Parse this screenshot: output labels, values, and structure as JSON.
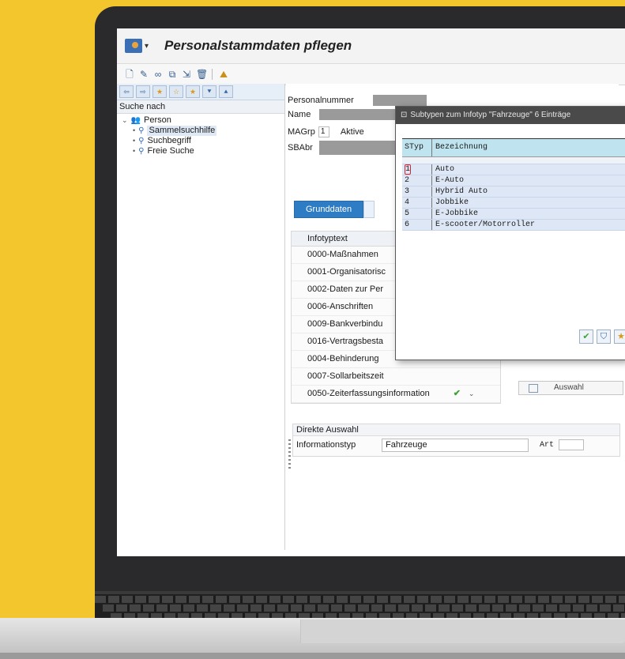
{
  "window": {
    "title": "Personalstammdaten pflegen"
  },
  "left_panel": {
    "header": "Suche nach",
    "tree": [
      {
        "label": "Person"
      },
      {
        "label": "Sammelsuchhilfe"
      },
      {
        "label": "Suchbegriff"
      },
      {
        "label": "Freie Suche"
      }
    ]
  },
  "header_fields": {
    "personalnummer_label": "Personalnummer",
    "name_label": "Name",
    "magrp_label": "MAGrp",
    "magrp_value": "1",
    "magrp_text": "Aktive",
    "sbabr_label": "SBAbr"
  },
  "tabs": [
    {
      "label": "Grunddaten"
    }
  ],
  "infotypes": {
    "header": "Infotyptext",
    "items": [
      "0000-Maßnahmen",
      "0001-Organisatorisc",
      "0002-Daten zur Per",
      "0006-Anschriften",
      "0009-Bankverbindu",
      "0016-Vertragsbesta",
      "0004-Behinderung",
      "0007-Sollarbeitszeit",
      "0050-Zeiterfassungsinformation"
    ]
  },
  "auswahl_label": "Auswahl",
  "direct": {
    "header": "Direkte Auswahl",
    "label": "Informationstyp",
    "value": "Fahrzeuge",
    "art_label": "Art"
  },
  "popup": {
    "title": "Subtypen zum Infotyp \"Fahrzeuge\" 6 Einträge",
    "col_styp": "STyp",
    "col_bez": "Bezeichnung",
    "rows": [
      {
        "styp": "1",
        "bez": "Auto"
      },
      {
        "styp": "2",
        "bez": "E-Auto"
      },
      {
        "styp": "3",
        "bez": "Hybrid Auto"
      },
      {
        "styp": "4",
        "bez": "Jobbike"
      },
      {
        "styp": "5",
        "bez": "E-Jobbike"
      },
      {
        "styp": "6",
        "bez": "E-scooter/Motorroller"
      }
    ]
  },
  "colors": {
    "background": "#f2c62c",
    "tab_active": "#2e7cc4",
    "popup_header": "#bfe4ef"
  }
}
